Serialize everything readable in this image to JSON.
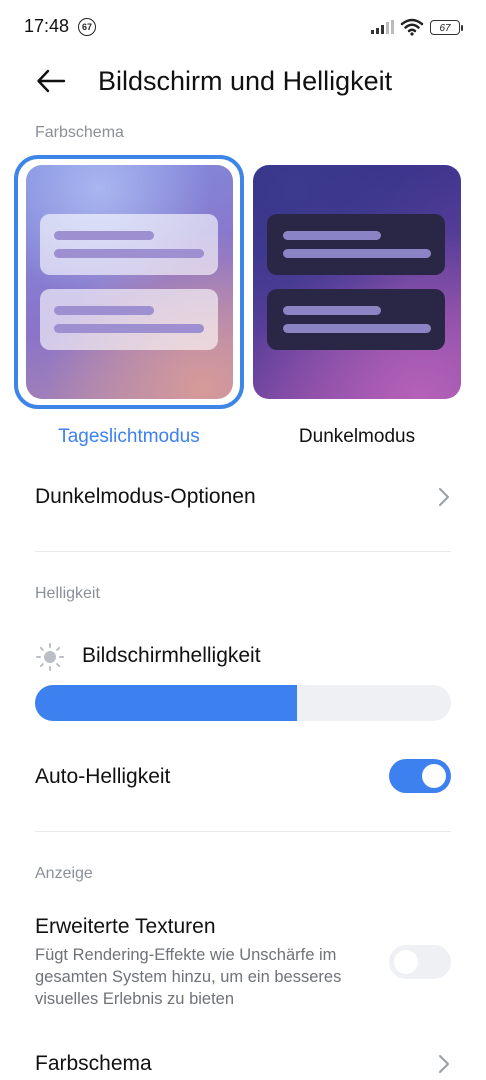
{
  "status_bar": {
    "time": "17:48",
    "notification_badge": "67",
    "battery_level": "67",
    "icons": [
      "signal-icon",
      "wifi-icon",
      "battery-icon"
    ]
  },
  "header": {
    "title": "Bildschirm und Helligkeit",
    "back_icon": "arrow-left-icon"
  },
  "color_scheme": {
    "section_label": "Farbschema",
    "options": [
      {
        "label": "Tageslichtmodus",
        "selected": true
      },
      {
        "label": "Dunkelmodus",
        "selected": false
      }
    ]
  },
  "dark_mode_options": {
    "label": "Dunkelmodus-Optionen"
  },
  "brightness": {
    "section_label": "Helligkeit",
    "slider_label": "Bildschirmhelligkeit",
    "level_percent": 63,
    "auto_label": "Auto-Helligkeit",
    "auto_enabled": true
  },
  "display": {
    "section_label": "Anzeige",
    "textures_title": "Erweiterte Texturen",
    "textures_description": "Fügt Rendering-Effekte wie Unschärfe im gesamten System hinzu, um ein besseres visuelles Erlebnis zu bieten",
    "textures_enabled": false,
    "color_scheme_label": "Farbschema"
  },
  "colors": {
    "accent": "#3d80ef",
    "selected_border": "#3d85e6",
    "section_label": "#8a8f99"
  }
}
